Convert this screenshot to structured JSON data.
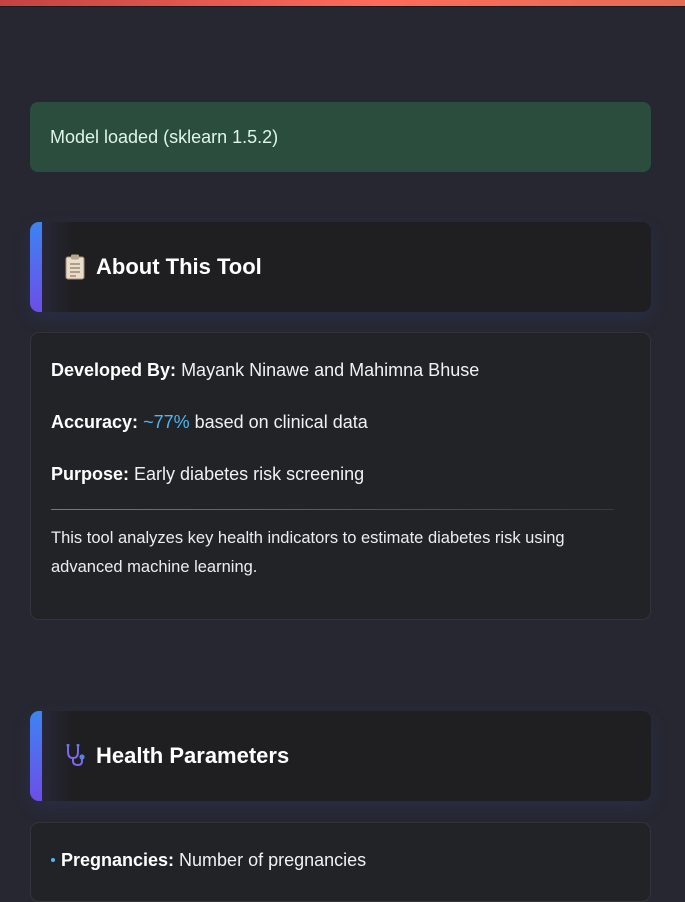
{
  "status": {
    "message": "Model loaded (sklearn 1.5.2)"
  },
  "about": {
    "icon": "clipboard-icon",
    "title": "About This Tool",
    "developed_label": "Developed By:",
    "developed_value": "Mayank Ninawe and Mahimna Bhuse",
    "accuracy_label": "Accuracy:",
    "accuracy_value": "~77%",
    "accuracy_suffix": " based on clinical data",
    "purpose_label": "Purpose:",
    "purpose_value": "Early diabetes risk screening",
    "description": "This tool analyzes key health indicators to estimate diabetes risk using advanced machine learning."
  },
  "health": {
    "icon": "stethoscope-icon",
    "title": "Health Parameters",
    "params": [
      {
        "label": "Pregnancies:",
        "value": "Number of pregnancies"
      }
    ]
  },
  "colors": {
    "background": "#262730",
    "success_bg": "#2b4d3e",
    "accent_blue": "#3c84f2",
    "accent_purple": "#6d4ee8",
    "highlight": "#4fb4f2",
    "top_bar": "#ff6b5b"
  }
}
